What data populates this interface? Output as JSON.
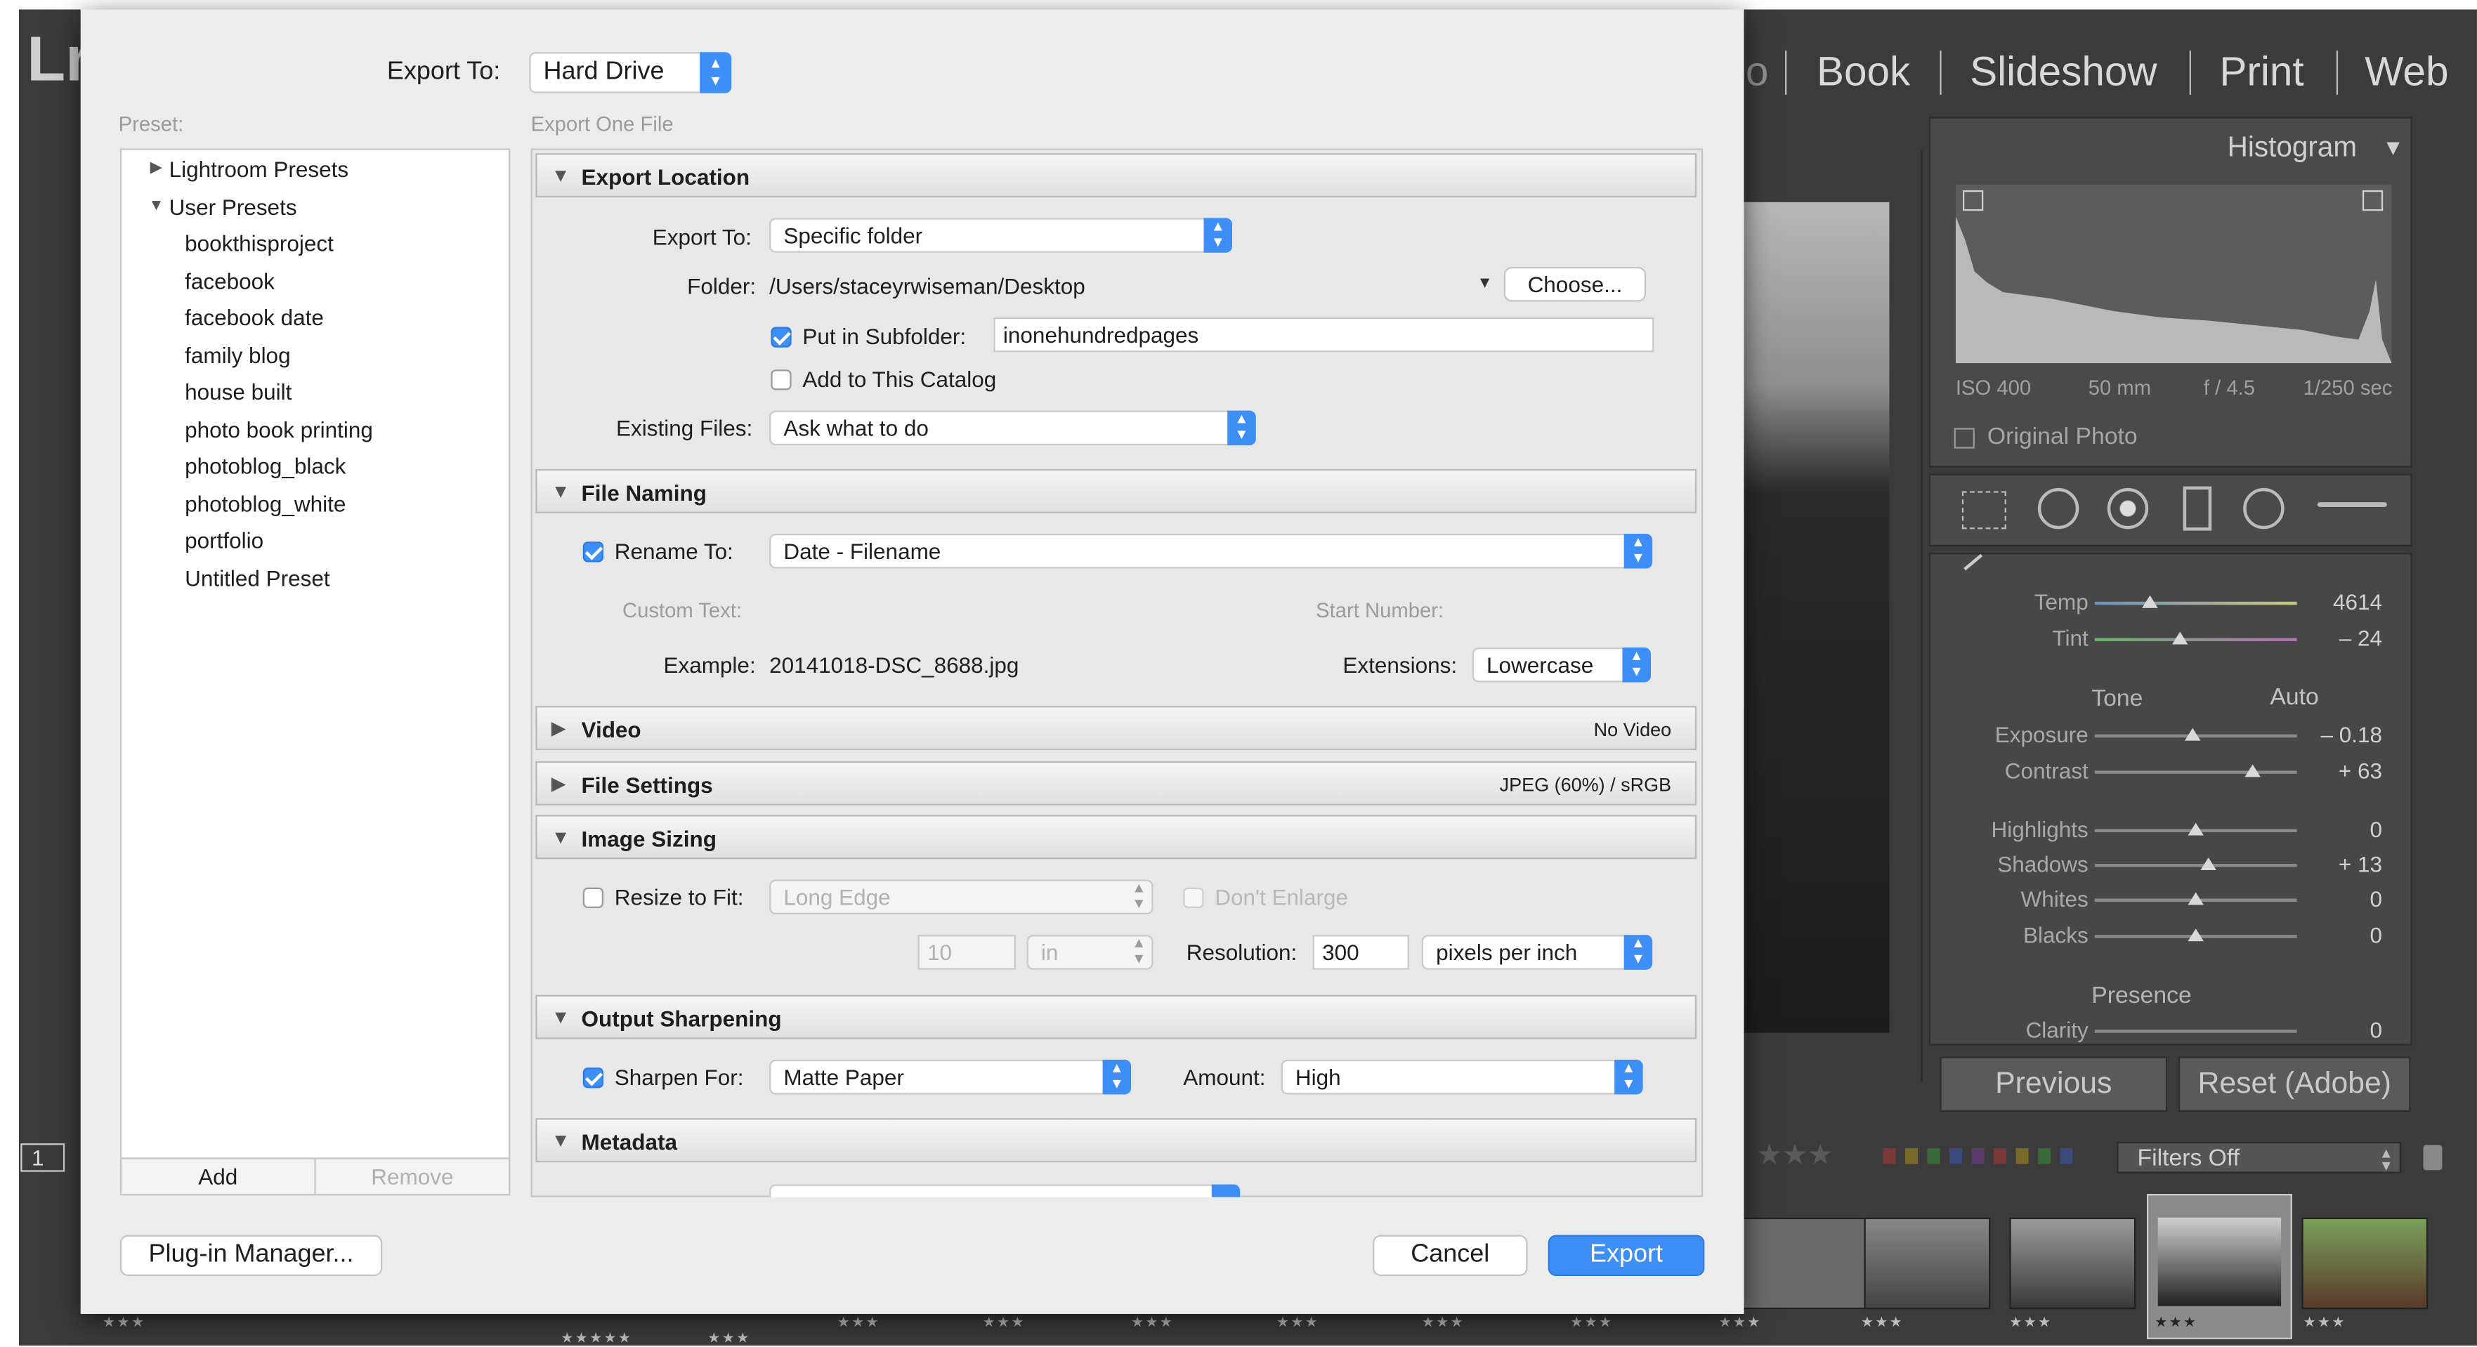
{
  "lightroom": {
    "logo": "Lr",
    "modules": [
      "o",
      "Book",
      "Slideshow",
      "Print",
      "Web"
    ],
    "histogram": {
      "title": "Histogram",
      "iso": "ISO 400",
      "focal": "50 mm",
      "aperture": "f / 4.5",
      "shutter": "1/250 sec",
      "original_photo": "Original Photo"
    },
    "basic": {
      "temp_label": "Temp",
      "temp_value": "4614",
      "tint_label": "Tint",
      "tint_value": "– 24",
      "tone_label": "Tone",
      "auto_label": "Auto",
      "exposure_label": "Exposure",
      "exposure_value": "– 0.18",
      "contrast_label": "Contrast",
      "contrast_value": "+ 63",
      "highlights_label": "Highlights",
      "highlights_value": "0",
      "shadows_label": "Shadows",
      "shadows_value": "+ 13",
      "whites_label": "Whites",
      "whites_value": "0",
      "blacks_label": "Blacks",
      "blacks_value": "0",
      "presence_label": "Presence",
      "clarity_label": "Clarity",
      "clarity_value": "0"
    },
    "previous_label": "Previous",
    "reset_label": "Reset (Adobe)",
    "filters_label": "Filters Off",
    "page_number": "1",
    "film_stars": [
      "★★★",
      "★★★",
      "★★★",
      "★★★",
      "★★★",
      "★★★★★",
      "★★★",
      "★★★",
      "★★★",
      "★★★",
      "★★★",
      "★★★",
      "★★★",
      "★★★",
      "★★★",
      "★★★"
    ]
  },
  "dialog": {
    "export_to_label": "Export To:",
    "export_to_value": "Hard Drive",
    "preset_label": "Preset:",
    "subtitle": "Export One File",
    "presets": {
      "lightroom_presets": "Lightroom Presets",
      "user_presets": "User Presets",
      "items": [
        "bookthisproject",
        "facebook",
        "facebook date",
        "family blog",
        "house built",
        "photo book printing",
        "photoblog_black",
        "photoblog_white",
        "portfolio",
        "Untitled Preset"
      ]
    },
    "add_label": "Add",
    "remove_label": "Remove",
    "plugin_manager_label": "Plug-in Manager...",
    "cancel_label": "Cancel",
    "export_label": "Export",
    "sections": {
      "export_location": {
        "title": "Export Location",
        "export_to_label": "Export To:",
        "export_to_value": "Specific folder",
        "folder_label": "Folder:",
        "folder_value": "/Users/staceyrwiseman/Desktop",
        "choose_label": "Choose...",
        "put_in_subfolder_label": "Put in Subfolder:",
        "put_in_subfolder_checked": true,
        "subfolder_value": "inonehundredpages",
        "add_to_catalog_label": "Add to This Catalog",
        "add_to_catalog_checked": false,
        "existing_files_label": "Existing Files:",
        "existing_files_value": "Ask what to do"
      },
      "file_naming": {
        "title": "File Naming",
        "rename_to_label": "Rename To:",
        "rename_to_checked": true,
        "rename_to_value": "Date - Filename",
        "custom_text_label": "Custom Text:",
        "start_number_label": "Start Number:",
        "example_label": "Example:",
        "example_value": "20141018-DSC_8688.jpg",
        "extensions_label": "Extensions:",
        "extensions_value": "Lowercase"
      },
      "video": {
        "title": "Video",
        "summary": "No Video"
      },
      "file_settings": {
        "title": "File Settings",
        "summary": "JPEG (60%) / sRGB"
      },
      "image_sizing": {
        "title": "Image Sizing",
        "resize_label": "Resize to Fit:",
        "resize_checked": false,
        "resize_value": "Long Edge",
        "dont_enlarge_label": "Don't Enlarge",
        "size_value": "10",
        "unit_value": "in",
        "resolution_label": "Resolution:",
        "resolution_value": "300",
        "resolution_unit": "pixels per inch"
      },
      "output_sharpening": {
        "title": "Output Sharpening",
        "sharpen_for_label": "Sharpen For:",
        "sharpen_checked": true,
        "sharpen_for_value": "Matte Paper",
        "amount_label": "Amount:",
        "amount_value": "High"
      },
      "metadata": {
        "title": "Metadata"
      }
    }
  }
}
